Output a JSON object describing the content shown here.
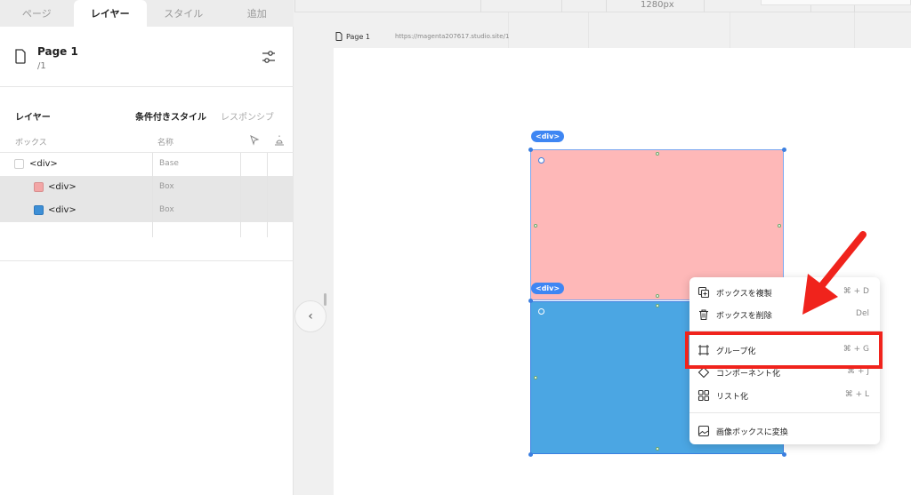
{
  "tabs": [
    {
      "label": "ページ"
    },
    {
      "label": "レイヤー"
    },
    {
      "label": "スタイル"
    },
    {
      "label": "追加"
    }
  ],
  "page": {
    "name": "Page 1",
    "path": "/1"
  },
  "layers": {
    "title": "レイヤー",
    "conditional_style": "条件付きスタイル",
    "responsive": "レスポンシブ",
    "col_box": "ボックス",
    "col_name": "名称",
    "rows": [
      {
        "label": "<div>",
        "type": "Base",
        "swatch": "#ffffff"
      },
      {
        "label": "<div>",
        "type": "Box",
        "swatch": "#f3a6a6"
      },
      {
        "label": "<div>",
        "type": "Box",
        "swatch": "#3d8fd6"
      }
    ]
  },
  "canvas": {
    "ruler_label": "1280px",
    "page_label": "Page 1",
    "page_url": "https://magenta207617.studio.site/1",
    "tag_top": "<div>",
    "tag_bottom": "<div>",
    "pink_color": "#feb8b8",
    "blue_color": "#4ba6e3"
  },
  "context_menu": {
    "items": [
      {
        "label": "ボックスを複製",
        "shortcut": "⌘ + D",
        "icon": "duplicate-icon"
      },
      {
        "label": "ボックスを削除",
        "shortcut": "Del",
        "icon": "trash-icon"
      },
      {
        "label": "グループ化",
        "shortcut": "⌘ + G",
        "icon": "group-icon"
      },
      {
        "label": "コンポーネント化",
        "shortcut": "⌘ + J",
        "icon": "component-icon"
      },
      {
        "label": "リスト化",
        "shortcut": "⌘ + L",
        "icon": "list-icon"
      },
      {
        "label": "画像ボックスに変換",
        "shortcut": "",
        "icon": "image-icon"
      }
    ]
  },
  "annotation": {
    "highlight_color": "#f0231c"
  }
}
